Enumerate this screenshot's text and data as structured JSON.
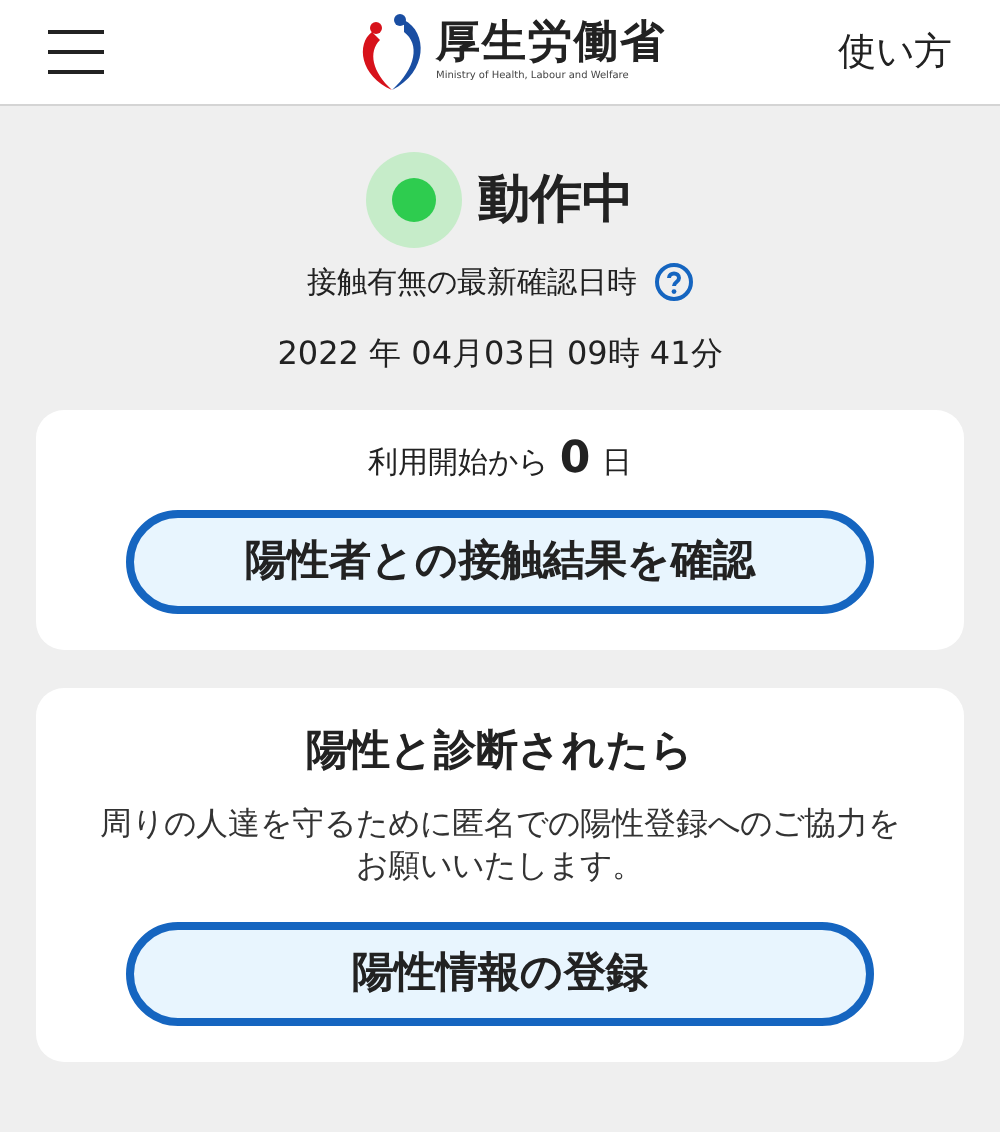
{
  "header": {
    "logo_title": "厚生労働省",
    "logo_subtitle": "Ministry of Health, Labour and Welfare",
    "help_link": "使い方"
  },
  "status": {
    "label": "動作中",
    "last_check_label": "接触有無の最新確認日時",
    "last_check_time": "2022 年 04月03日 09時 41分"
  },
  "usage": {
    "prefix": "利用開始から",
    "days": "0",
    "suffix": "日",
    "button": "陽性者との接触結果を確認"
  },
  "positive": {
    "title": "陽性と診断されたら",
    "message": "周りの人達を守るために匿名での陽性登録へのご協力をお願いいたします。",
    "button": "陽性情報の登録"
  }
}
